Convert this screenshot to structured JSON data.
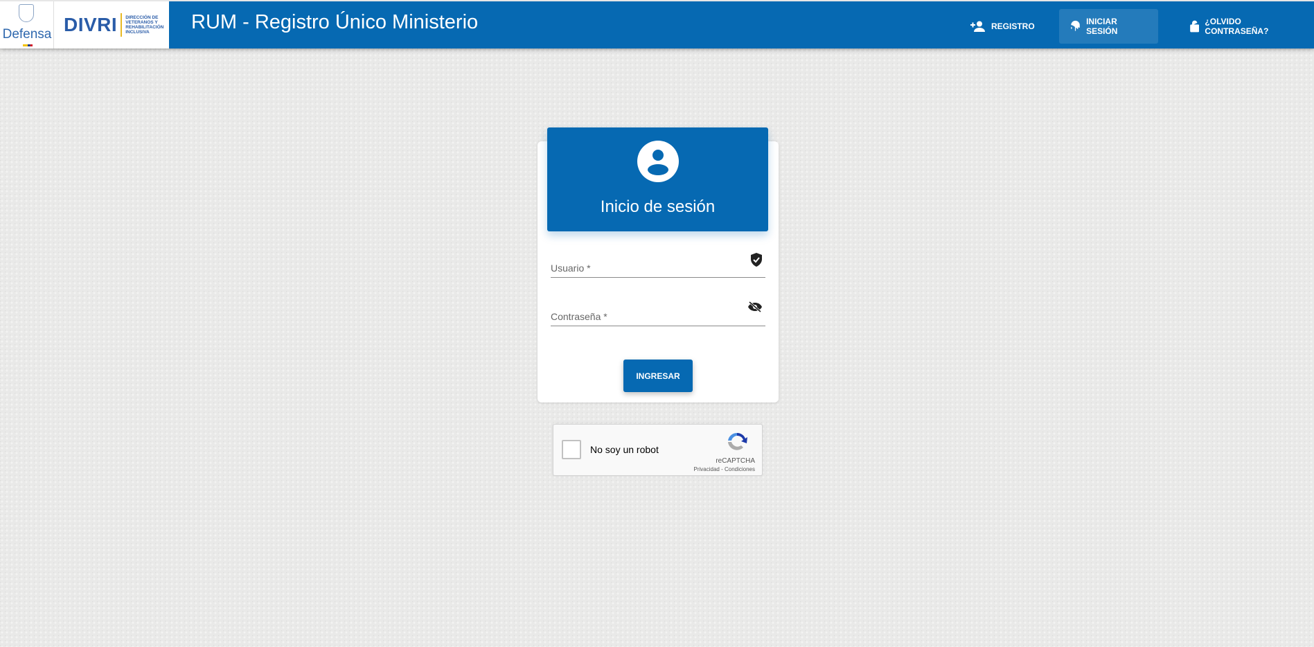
{
  "header": {
    "logo_defensa": "Defensa",
    "logo_divri": "DIVRI",
    "logo_divri_sub": "DIRECCIÓN DE VETERANOS Y REHABILITACIÓN INCLUSIVA",
    "title": "RUM - Registro Único Ministerio",
    "nav": [
      {
        "label": "REGISTRO",
        "icon": "person-add-icon"
      },
      {
        "label": "INICIAR SESIÓN",
        "icon": "fingerprint-icon"
      },
      {
        "label": "¿OLVIDO CONTRASEÑA?",
        "icon": "lock-open-icon"
      }
    ]
  },
  "login": {
    "title": "Inicio de sesión",
    "username_label": "Usuario *",
    "password_label": "Contraseña *",
    "submit": "INGRESAR"
  },
  "captcha": {
    "label": "No soy un robot",
    "brand": "reCAPTCHA",
    "links": "Privacidad - Condiciones"
  },
  "colors": {
    "primary": "#0669b2"
  }
}
